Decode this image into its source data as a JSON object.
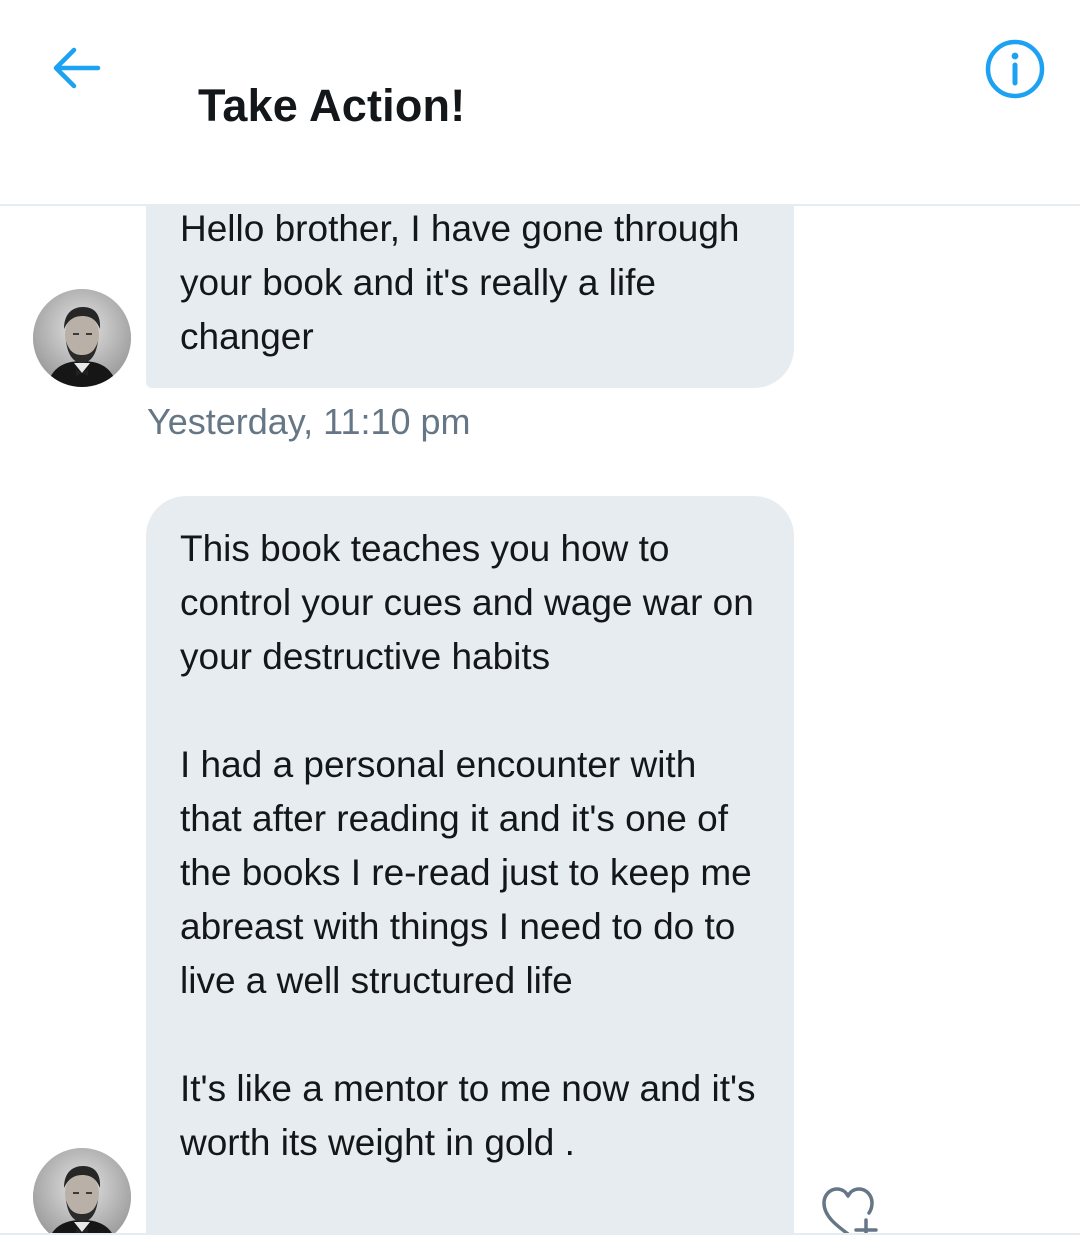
{
  "header": {
    "title": "Take Action!",
    "back_icon": "arrow-left-icon",
    "info_icon": "info-circle-icon",
    "accent_color": "#1da1f2"
  },
  "messages": [
    {
      "paragraphs": [
        "Hello brother, I have gone through your book and it's really a life changer"
      ],
      "timestamp": "Yesterday, 11:10 pm"
    },
    {
      "paragraphs": [
        "This book teaches you how to control your cues and wage war on your destructive habits",
        "I had a personal encounter with that after reading it and it's one of the books I re-read just to keep me abreast with things I need to do to live a well structured life",
        "It's like a mentor to me now and it's worth its weight in gold ."
      ]
    }
  ],
  "reaction_icon": "heart-plus-icon",
  "colors": {
    "bubble": "#e6ecf0",
    "text": "#14171a",
    "muted": "#657786"
  }
}
